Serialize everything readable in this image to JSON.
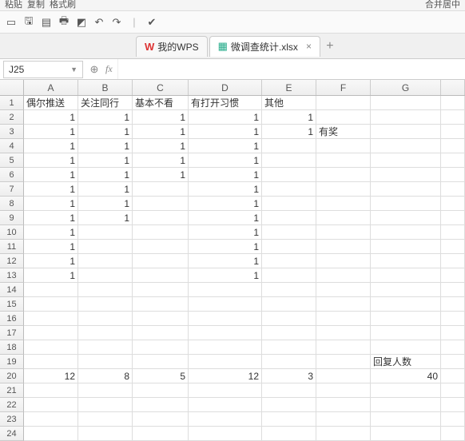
{
  "top": {
    "paste": "粘贴",
    "copy": "复制",
    "fmt": "格式刷",
    "merge": "合并居中"
  },
  "tabs": {
    "wps": "我的WPS",
    "file": "微调查统计.xlsx"
  },
  "cellref": "J25",
  "cols": [
    "A",
    "B",
    "C",
    "D",
    "E",
    "F",
    "G"
  ],
  "headers": {
    "A": "偶尔推送",
    "B": "关注同行",
    "C": "基本不看",
    "D": "有打开习惯",
    "E": "其他",
    "F": "",
    "G": ""
  },
  "f3": "有奖",
  "g19": "回复人数",
  "totals": {
    "A": "12",
    "B": "8",
    "C": "5",
    "D": "12",
    "E": "3",
    "G": "40"
  },
  "matrix": {
    "2": {
      "A": "1",
      "B": "1",
      "C": "1",
      "D": "1",
      "E": "1"
    },
    "3": {
      "A": "1",
      "B": "1",
      "C": "1",
      "D": "1",
      "E": "1"
    },
    "4": {
      "A": "1",
      "B": "1",
      "C": "1",
      "D": "1"
    },
    "5": {
      "A": "1",
      "B": "1",
      "C": "1",
      "D": "1"
    },
    "6": {
      "A": "1",
      "B": "1",
      "C": "1",
      "D": "1"
    },
    "7": {
      "A": "1",
      "B": "1",
      "D": "1"
    },
    "8": {
      "A": "1",
      "B": "1",
      "D": "1"
    },
    "9": {
      "A": "1",
      "B": "1",
      "D": "1"
    },
    "10": {
      "A": "1",
      "D": "1"
    },
    "11": {
      "A": "1",
      "D": "1"
    },
    "12": {
      "A": "1",
      "D": "1"
    },
    "13": {
      "A": "1",
      "D": "1"
    }
  }
}
